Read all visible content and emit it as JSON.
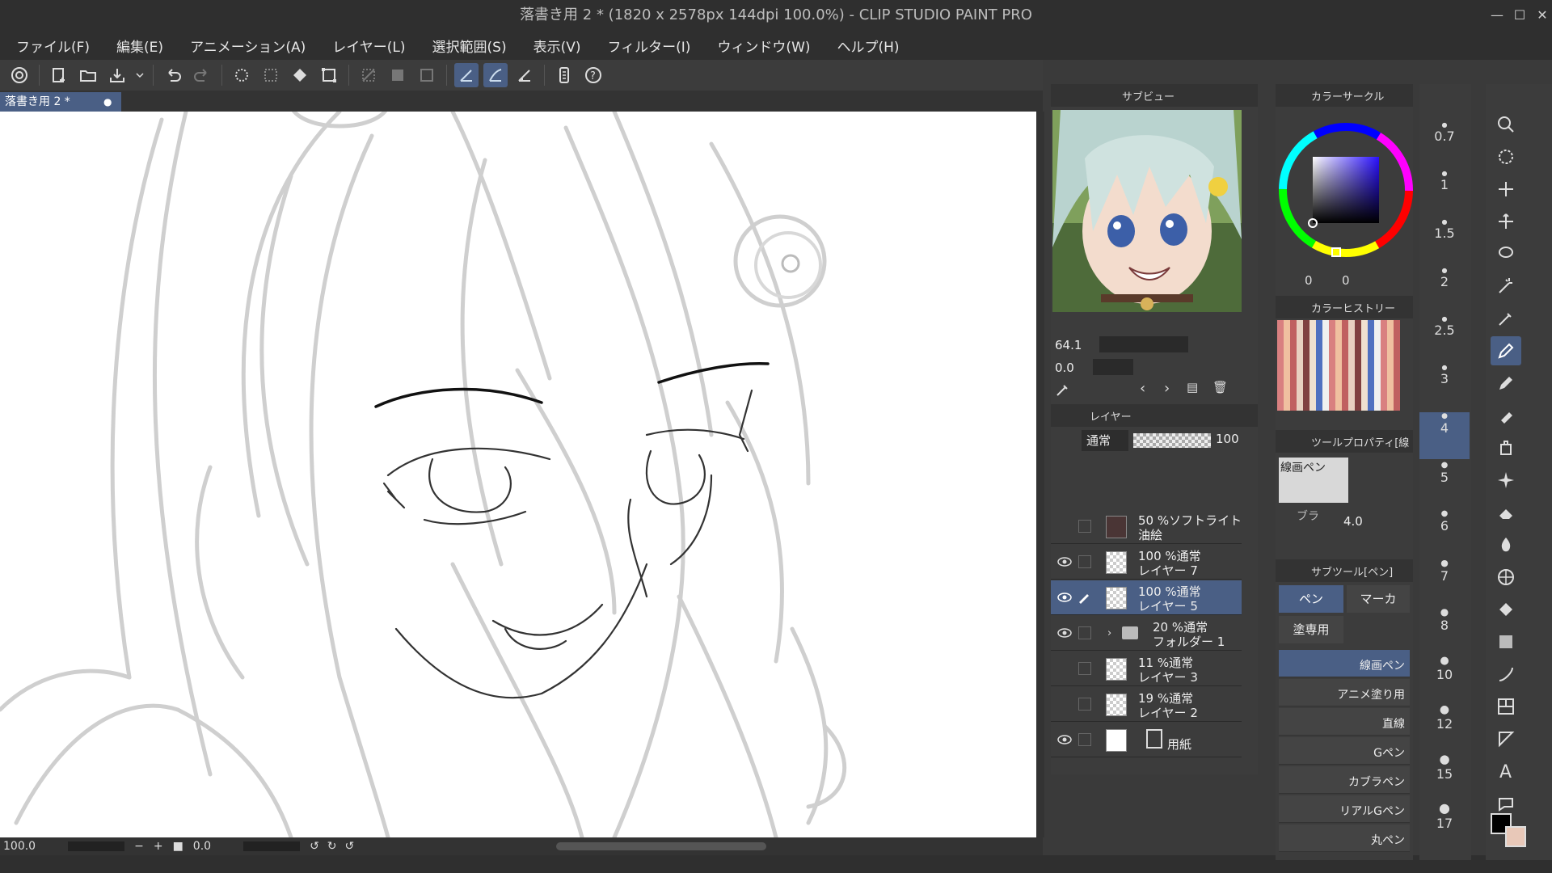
{
  "window": {
    "title": "落書き用 2 * (1820 x 2578px 144dpi 100.0%)  - CLIP STUDIO PAINT PRO"
  },
  "menu": [
    "ファイル(F)",
    "編集(E)",
    "アニメーション(A)",
    "レイヤー(L)",
    "選択範囲(S)",
    "表示(V)",
    "フィルター(I)",
    "ウィンドウ(W)",
    "ヘルプ(H)"
  ],
  "tab": {
    "label": "落書き用 2 *"
  },
  "status": {
    "zoom": "100.0",
    "rotation": "0.0"
  },
  "subview": {
    "tab_label": "サブビュー",
    "zoom": "64.1",
    "rotation": "0.0"
  },
  "color_circle": {
    "label": "カラーサークル",
    "v1": "0",
    "v2": "0"
  },
  "color_history": {
    "label": "カラーヒストリー"
  },
  "tool_property": {
    "label": "ツールプロパティ[線",
    "brush_name": "線画ペン",
    "size_label": "ブラ",
    "size_value": "4.0"
  },
  "sub_tool": {
    "label": "サブツール[ペン]",
    "tab_pen": "ペン",
    "tab_marker": "マーカ",
    "tab_fill": "塗専用",
    "brushes": [
      "線画ペン",
      "アニメ塗り用",
      "直線",
      "Gペン",
      "カブラペン",
      "リアルGペン",
      "丸ペン"
    ]
  },
  "layer_panel": {
    "tab_label": "レイヤー",
    "blend_mode": "通常",
    "opacity": "100",
    "layers": [
      {
        "line1": "50 %ソフトライト",
        "line2": "油絵"
      },
      {
        "line1": "100 %通常",
        "line2": "レイヤー 7"
      },
      {
        "line1": "100 %通常",
        "line2": "レイヤー 5"
      },
      {
        "line1": "20 %通常",
        "line2": "フォルダー 1"
      },
      {
        "line1": "11 %通常",
        "line2": "レイヤー 3"
      },
      {
        "line1": "19 %通常",
        "line2": "レイヤー 2"
      },
      {
        "line1": "",
        "line2": "用紙"
      }
    ]
  },
  "brush_sizes": [
    "0.7",
    "1",
    "1.5",
    "2",
    "2.5",
    "3",
    "4",
    "5",
    "6",
    "7",
    "8",
    "10",
    "12",
    "15",
    "17"
  ],
  "colors": {
    "accent": "#4a5f85",
    "panel": "#3c3c3c",
    "titlebar": "#2f2f2f",
    "canvas": "#ffffff"
  }
}
